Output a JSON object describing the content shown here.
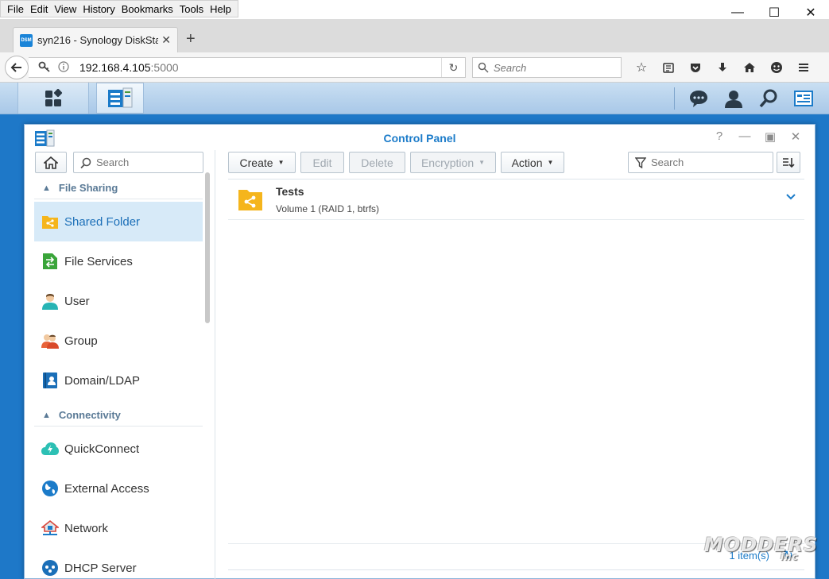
{
  "browser": {
    "menu": [
      "File",
      "Edit",
      "View",
      "History",
      "Bookmarks",
      "Tools",
      "Help"
    ],
    "tab": {
      "favicon": "DSM",
      "title": "syn216 - Synology DiskSta..."
    },
    "url": {
      "host": "192.168.4.105",
      "port": ":5000"
    },
    "search_placeholder": "Search"
  },
  "control_panel": {
    "title": "Control Panel",
    "sidebar": {
      "search_placeholder": "Search",
      "sections": [
        {
          "label": "File Sharing"
        },
        {
          "label": "Connectivity"
        }
      ],
      "items": [
        {
          "label": "Shared Folder"
        },
        {
          "label": "File Services"
        },
        {
          "label": "User"
        },
        {
          "label": "Group"
        },
        {
          "label": "Domain/LDAP"
        },
        {
          "label": "QuickConnect"
        },
        {
          "label": "External Access"
        },
        {
          "label": "Network"
        },
        {
          "label": "DHCP Server"
        }
      ]
    },
    "toolbar": {
      "create": "Create",
      "edit": "Edit",
      "delete": "Delete",
      "encryption": "Encryption",
      "action": "Action",
      "search_placeholder": "Search"
    },
    "folders": [
      {
        "name": "Tests",
        "detail": "Volume 1 (RAID 1, btrfs)"
      }
    ],
    "status_count": "1 item(s)"
  },
  "watermark": {
    "line1": "MODDERS",
    "line2": "inc"
  },
  "colors": {
    "accent": "#1b7bc9",
    "folder": "#f5b51c",
    "desktop": "#1e78c8"
  }
}
